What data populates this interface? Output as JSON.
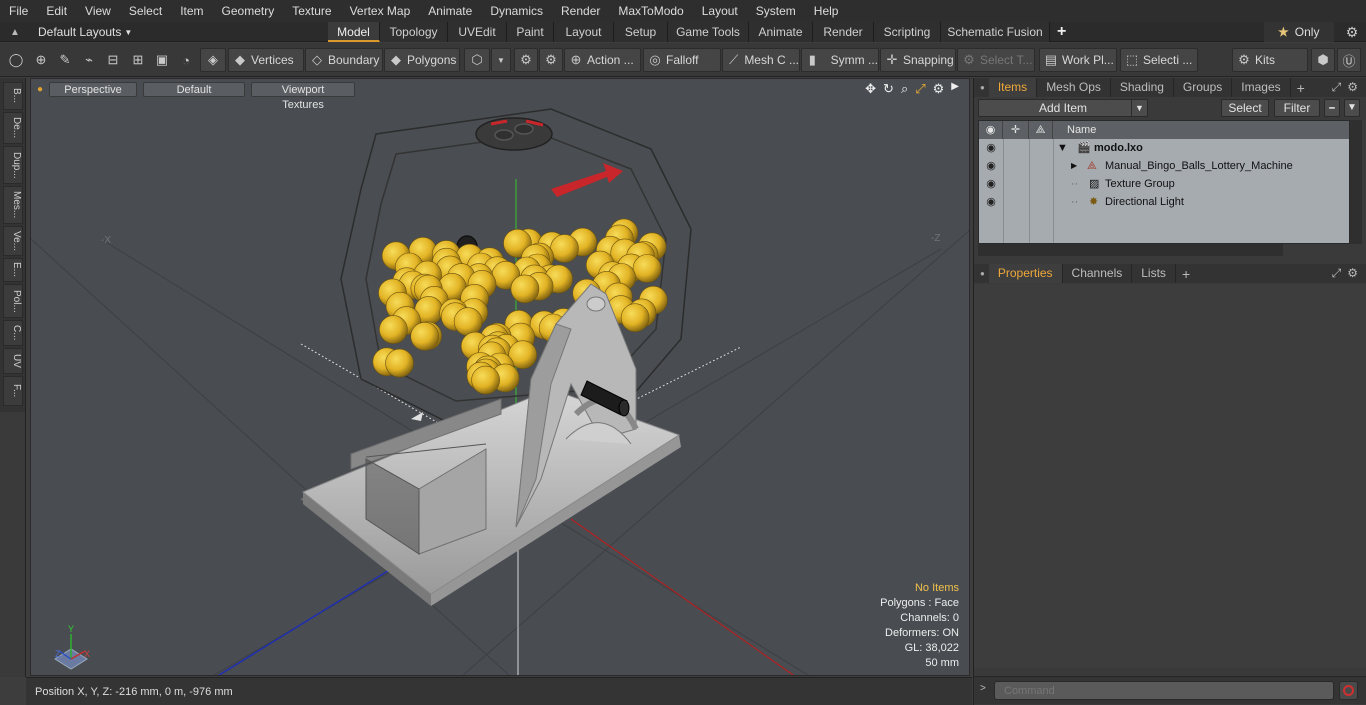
{
  "menubar": {
    "items": [
      "File",
      "Edit",
      "View",
      "Select",
      "Item",
      "Geometry",
      "Texture",
      "Vertex Map",
      "Animate",
      "Dynamics",
      "Render",
      "MaxToModo",
      "Layout",
      "System",
      "Help"
    ]
  },
  "layouts": {
    "label": "Default Layouts"
  },
  "tabs": [
    {
      "label": "Model",
      "active": true
    },
    {
      "label": "Topology"
    },
    {
      "label": "UVEdit"
    },
    {
      "label": "Paint"
    },
    {
      "label": "Layout"
    },
    {
      "label": "Setup"
    },
    {
      "label": "Game Tools"
    },
    {
      "label": "Animate"
    },
    {
      "label": "Render"
    },
    {
      "label": "Scripting"
    },
    {
      "label": "Schematic Fusion"
    }
  ],
  "only": {
    "star": "★",
    "label": "Only"
  },
  "toolbar": {
    "vertices": "Vertices",
    "boundary": "Boundary",
    "polygons": "Polygons",
    "action": "Action ...",
    "falloff": "Falloff",
    "mesh": "Mesh C ...",
    "symm": "Symm ...",
    "snapping": "Snapping",
    "select_t": "Select T...",
    "work_pl": "Work Pl...",
    "selecti": "Selecti ...",
    "kits": "Kits"
  },
  "left_tabs": [
    "B...",
    "De...",
    "Dup...",
    "Mes...",
    "Ve...",
    "E...",
    "Pol...",
    "C...",
    "UV",
    "F..."
  ],
  "viewport": {
    "perspective": "Perspective",
    "default": "Default",
    "textures": "Viewport Textures",
    "axis_neg_x": "-X",
    "axis_neg_z": "-Z",
    "stats": {
      "no_items": "No Items",
      "polygons": "Polygons : Face",
      "channels": "Channels: 0",
      "deformers": "Deformers: ON",
      "gl": "GL: 38,022",
      "mm": "50 mm"
    },
    "gizmo": {
      "x": "X",
      "y": "Y",
      "z": "Z"
    }
  },
  "statusbar": {
    "position": "Position X, Y, Z:   -216 mm, 0 m, -976 mm"
  },
  "items_panel": {
    "tabs": [
      {
        "label": "Items",
        "active": true
      },
      {
        "label": "Mesh Ops"
      },
      {
        "label": "Shading"
      },
      {
        "label": "Groups"
      },
      {
        "label": "Images"
      }
    ],
    "add_item": "Add Item",
    "select": "Select",
    "filter": "Filter",
    "name_col": "Name",
    "rows": [
      {
        "label": "modo.lxo"
      },
      {
        "label": "Manual_Bingo_Balls_Lottery_Machine"
      },
      {
        "label": "Texture Group"
      },
      {
        "label": "Directional Light"
      }
    ]
  },
  "props_panel": {
    "tabs": [
      {
        "label": "Properties",
        "active": true
      },
      {
        "label": "Channels"
      },
      {
        "label": "Lists"
      }
    ]
  },
  "command": {
    "placeholder": "Command"
  },
  "colors": {
    "accent": "#d99a2b",
    "ball": "#e7b928",
    "arrow": "#c8262a"
  }
}
